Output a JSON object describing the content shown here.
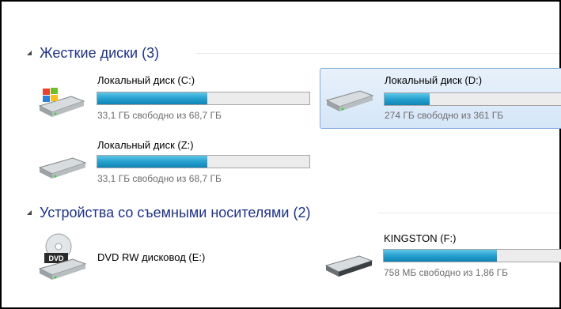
{
  "groups": [
    {
      "title": "Жесткие диски (3)",
      "drives": [
        {
          "name": "Локальный диск (C:)",
          "status": "33,1 ГБ свободно из 68,7 ГБ",
          "used_fraction": 0.52,
          "icon": "windows-drive-icon"
        },
        {
          "name": "Локальный диск (D:)",
          "status": "274 ГБ свободно из 361 ГБ",
          "used_fraction": 0.24,
          "icon": "hard-drive-icon",
          "selected": true
        },
        {
          "name": "Локальный диск (Z:)",
          "status": "33,1 ГБ свободно из 68,7 ГБ",
          "used_fraction": 0.52,
          "icon": "hard-drive-icon"
        }
      ]
    },
    {
      "title": "Устройства со съемными носителями (2)",
      "drives": [
        {
          "name": "DVD RW дисковод (E:)",
          "icon": "dvd-drive-icon",
          "icon_label": "DVD"
        },
        {
          "name": "KINGSTON (F:)",
          "status": "758 МБ свободно из 1,86 ГБ",
          "used_fraction": 0.6,
          "icon": "usb-drive-icon"
        }
      ]
    }
  ],
  "colors": {
    "group_header": "#1e3287",
    "bar_fill": "#2aa4d1",
    "selection_border": "#84acdd"
  }
}
